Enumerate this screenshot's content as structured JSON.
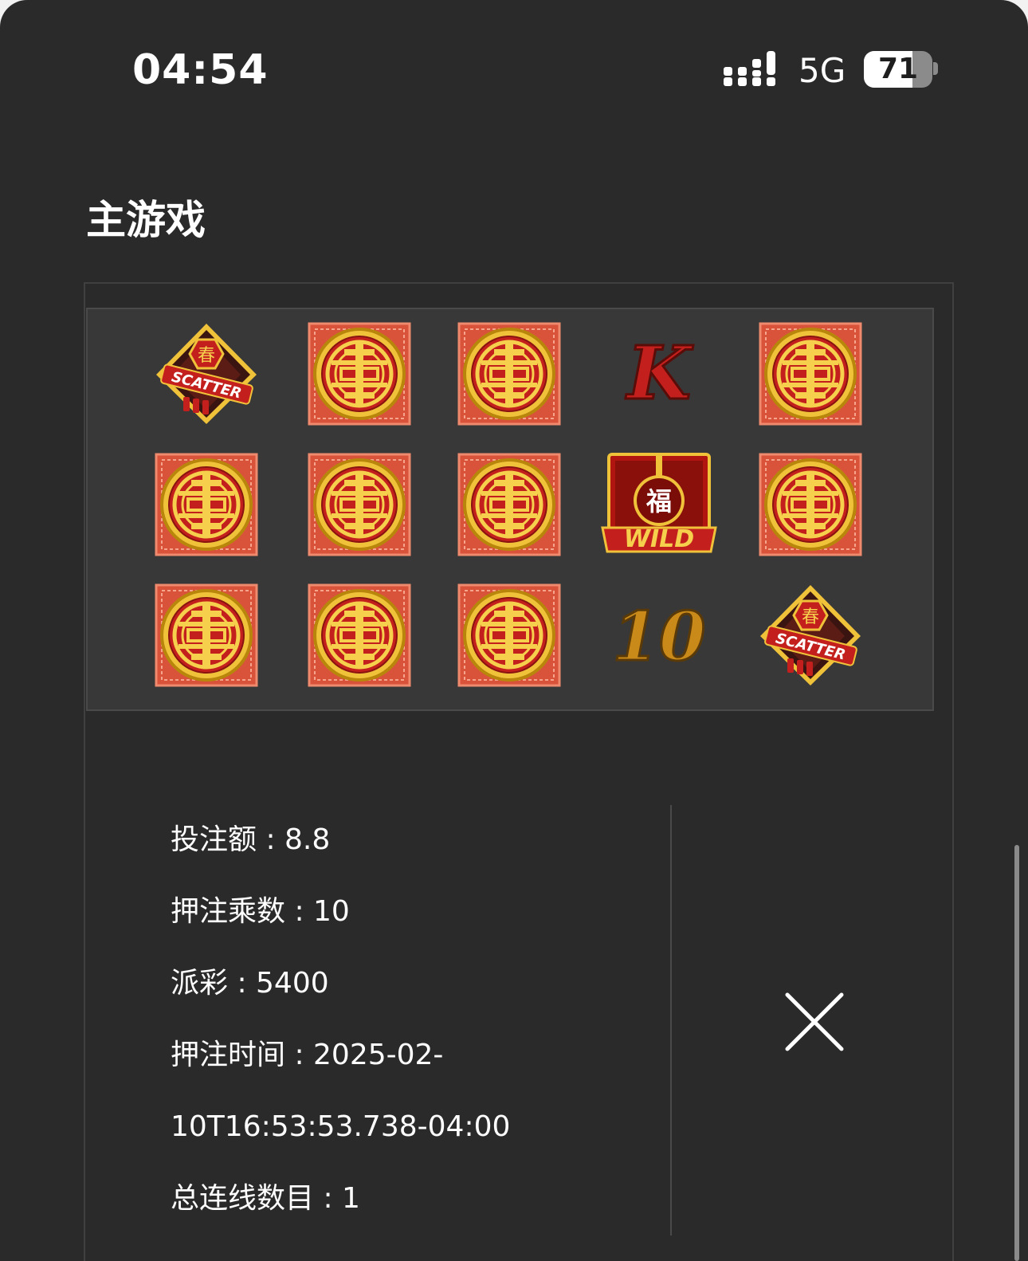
{
  "status_bar": {
    "time": "04:54",
    "network": "5G",
    "battery_level": "71",
    "battery_fraction": 0.71,
    "icons": [
      "signal-icon",
      "battery-icon"
    ]
  },
  "page": {
    "title": "主游戏"
  },
  "reels": {
    "rows": [
      [
        "scatter",
        "coin",
        "coin",
        "K",
        "coin"
      ],
      [
        "coin",
        "coin",
        "coin",
        "wild",
        "coin"
      ],
      [
        "coin",
        "coin",
        "coin",
        "10",
        "scatter"
      ]
    ],
    "symbol_text": {
      "scatter": "SCATTER",
      "scatter_glyph": "春",
      "wild": "WILD",
      "wild_glyph": "福",
      "K": "K",
      "10": "10"
    }
  },
  "bet_info": {
    "lines": [
      "投注额 : 8.8",
      "押注乘数 : 10",
      "派彩 : 5400",
      "押注时间 : 2025-02-",
      "10T16:53:53.738-04:00",
      "总连线数目 : 1"
    ]
  },
  "close_button": {
    "icon": "close-icon"
  },
  "colors": {
    "background": "#2a2a2a",
    "panel": "#383838",
    "text": "#ffffff",
    "gold": "#e8b623",
    "red": "#c0241e"
  }
}
